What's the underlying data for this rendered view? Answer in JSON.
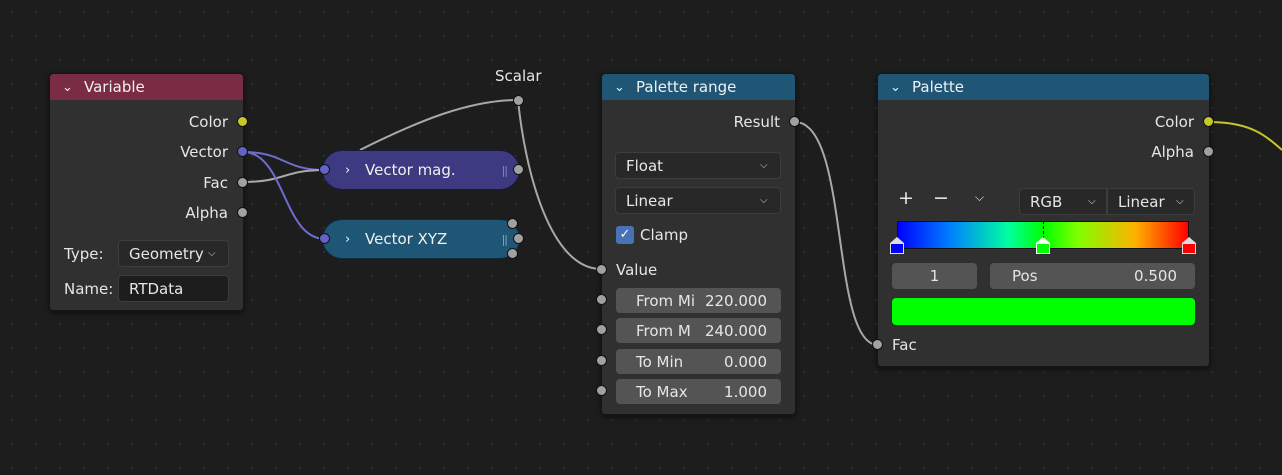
{
  "colors": {
    "variable_header": "#7b2c45",
    "node_header_blue": "#1f5675",
    "vector_chip": "#3d3a82",
    "vector_xyz_chip": "#1f5675",
    "wire_yellow": "#c7c729"
  },
  "variable_node": {
    "title": "Variable",
    "outputs": [
      "Color",
      "Vector",
      "Fac",
      "Alpha"
    ],
    "type_label": "Type:",
    "type_value": "Geometry",
    "name_label": "Name:",
    "name_value": "RTData"
  },
  "vector_mag": {
    "label": "Vector mag."
  },
  "vector_xyz": {
    "label": "Vector XYZ"
  },
  "scalar_reroute": {
    "label": "Scalar"
  },
  "palette_range_node": {
    "title": "Palette range",
    "output": "Result",
    "datatype": "Float",
    "interpolation": "Linear",
    "clamp_label": "Clamp",
    "clamp_checked": true,
    "value_label": "Value",
    "fields": [
      {
        "label": "From Mi",
        "value": "220.000"
      },
      {
        "label": "From M",
        "value": "240.000"
      },
      {
        "label": "To Min",
        "value": "0.000"
      },
      {
        "label": "To Max",
        "value": "1.000"
      }
    ]
  },
  "palette_node": {
    "title": "Palette",
    "outputs": [
      "Color",
      "Alpha"
    ],
    "add_icon": "+",
    "remove_icon": "−",
    "menu_icon": "chevron-down-icon",
    "color_mode": "RGB",
    "interpolation": "Linear",
    "active_index": "1",
    "pos_label": "Pos",
    "pos_value": "0.500",
    "swatch_color": "#00ff00",
    "fac_label": "Fac"
  }
}
